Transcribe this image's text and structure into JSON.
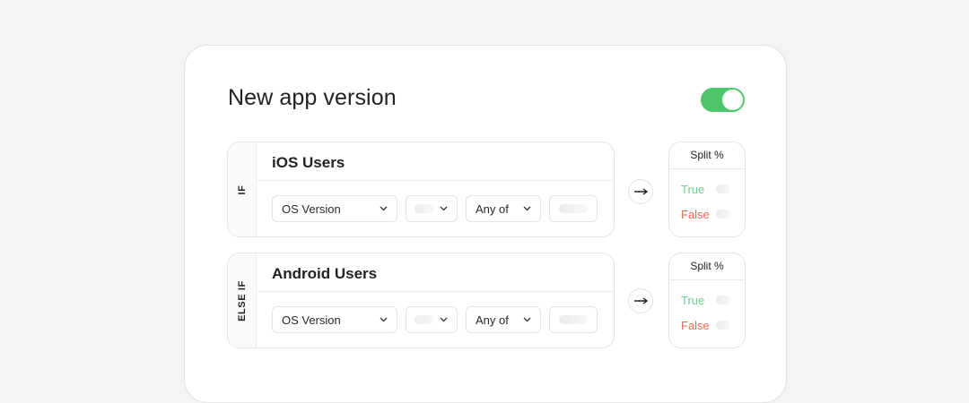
{
  "card": {
    "title": "New app version",
    "toggle_on": true
  },
  "colors": {
    "accent_green": "#4cc56b",
    "true_green": "#6fcf8e",
    "false_red": "#ea6a55"
  },
  "rules": [
    {
      "condition": "IF",
      "name": "iOS Users",
      "field": "OS Version",
      "operator": "Any of",
      "split": {
        "header": "Split %",
        "true_label": "True",
        "false_label": "False"
      }
    },
    {
      "condition": "ELSE IF",
      "name": "Android Users",
      "field": "OS Version",
      "operator": "Any of",
      "split": {
        "header": "Split %",
        "true_label": "True",
        "false_label": "False"
      }
    }
  ],
  "icons": {
    "arrow": "arrow-right-icon",
    "chevron": "chevron-down-icon"
  }
}
